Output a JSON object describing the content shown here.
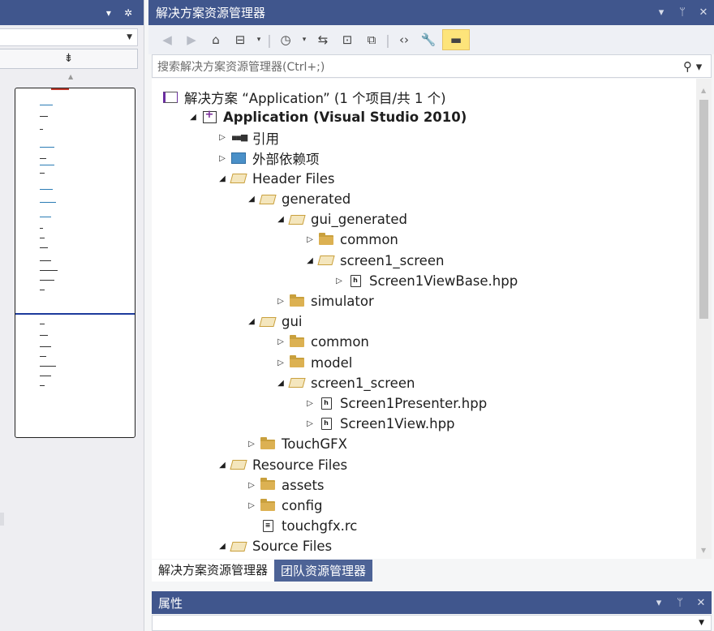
{
  "left_panel": {
    "title_ctrls": [
      "▾",
      "✲"
    ],
    "splitter_glyph": "⇟"
  },
  "solution_explorer": {
    "title": "解决方案资源管理器",
    "title_ctrls": [
      "▾",
      "ᛘ",
      "✕"
    ],
    "toolbar": [
      {
        "icon": "back-icon",
        "glyph": "◀",
        "dim": true
      },
      {
        "icon": "forward-icon",
        "glyph": "▶",
        "dim": true
      },
      {
        "icon": "home-icon",
        "glyph": "⌂"
      },
      {
        "icon": "switch-views-icon",
        "glyph": "⊟"
      },
      {
        "icon": "dropdown-arrow-icon",
        "glyph": "▾",
        "small": true
      },
      {
        "icon": "separator",
        "glyph": "|",
        "sep": true
      },
      {
        "icon": "pending-changes-filter-icon",
        "glyph": "◷"
      },
      {
        "icon": "dropdown-arrow-icon",
        "glyph": "▾",
        "small": true
      },
      {
        "icon": "sync-with-active-document-icon",
        "glyph": "⇆"
      },
      {
        "icon": "collapse-all-icon",
        "glyph": "⊡"
      },
      {
        "icon": "show-all-files-icon",
        "glyph": "⧉"
      },
      {
        "icon": "separator",
        "glyph": "|",
        "sep": true
      },
      {
        "icon": "view-code-icon",
        "glyph": "‹›"
      },
      {
        "icon": "properties-wrench-icon",
        "glyph": "🔧"
      },
      {
        "icon": "preview-selected-items-icon",
        "glyph": "▬",
        "active": true
      }
    ],
    "search": {
      "placeholder": "搜索解决方案资源管理器(Ctrl+;)",
      "icon_glyph": "⚲ ▾"
    },
    "tree": [
      {
        "depth": 0,
        "expander": "",
        "icon": "solution-icon",
        "label": "解决方案 “Application” (1 个项目/共 1 个)",
        "bold": false
      },
      {
        "depth": 0,
        "expander": "◢",
        "icon": "project-icon",
        "label": "Application (Visual Studio 2010)",
        "bold": true
      },
      {
        "depth": 1,
        "expander": "▷",
        "icon": "references-icon",
        "label": "引用"
      },
      {
        "depth": 1,
        "expander": "▷",
        "icon": "external-dependencies-icon",
        "label": "外部依赖项"
      },
      {
        "depth": 1,
        "expander": "◢",
        "icon": "folder-open-icon",
        "label": "Header Files"
      },
      {
        "depth": 2,
        "expander": "◢",
        "icon": "folder-open-icon",
        "label": "generated"
      },
      {
        "depth": 3,
        "expander": "◢",
        "icon": "folder-open-icon",
        "label": "gui_generated"
      },
      {
        "depth": 4,
        "expander": "▷",
        "icon": "folder-closed-icon",
        "label": "common"
      },
      {
        "depth": 4,
        "expander": "◢",
        "icon": "folder-open-icon",
        "label": "screen1_screen"
      },
      {
        "depth": 5,
        "expander": "▷",
        "icon": "header-file-icon",
        "label": "Screen1ViewBase.hpp"
      },
      {
        "depth": 3,
        "expander": "▷",
        "icon": "folder-closed-icon",
        "label": "simulator"
      },
      {
        "depth": 2,
        "expander": "◢",
        "icon": "folder-open-icon",
        "label": "gui"
      },
      {
        "depth": 3,
        "expander": "▷",
        "icon": "folder-closed-icon",
        "label": "common"
      },
      {
        "depth": 3,
        "expander": "▷",
        "icon": "folder-closed-icon",
        "label": "model"
      },
      {
        "depth": 3,
        "expander": "◢",
        "icon": "folder-open-icon",
        "label": "screen1_screen"
      },
      {
        "depth": 4,
        "expander": "▷",
        "icon": "header-file-icon",
        "label": "Screen1Presenter.hpp"
      },
      {
        "depth": 4,
        "expander": "▷",
        "icon": "header-file-icon",
        "label": "Screen1View.hpp"
      },
      {
        "depth": 2,
        "expander": "▷",
        "icon": "folder-closed-icon",
        "label": "TouchGFX"
      },
      {
        "depth": 1,
        "expander": "◢",
        "icon": "folder-open-icon",
        "label": "Resource Files"
      },
      {
        "depth": 2,
        "expander": "▷",
        "icon": "folder-closed-icon",
        "label": "assets"
      },
      {
        "depth": 2,
        "expander": "▷",
        "icon": "folder-closed-icon",
        "label": "config"
      },
      {
        "depth": 2,
        "expander": "",
        "icon": "resource-file-icon",
        "label": "touchgfx.rc"
      },
      {
        "depth": 1,
        "expander": "◢",
        "icon": "folder-open-icon",
        "label": "Source Files"
      }
    ],
    "tabs": [
      {
        "label": "解决方案资源管理器",
        "active": true
      },
      {
        "label": "团队资源管理器",
        "active": false
      }
    ]
  },
  "properties": {
    "title": "属性",
    "title_ctrls": [
      "▾",
      "ᛘ",
      "✕"
    ]
  },
  "colors": {
    "title_bar": "#40568d",
    "folder": "#dcb152",
    "active_tool": "#fde47a"
  }
}
